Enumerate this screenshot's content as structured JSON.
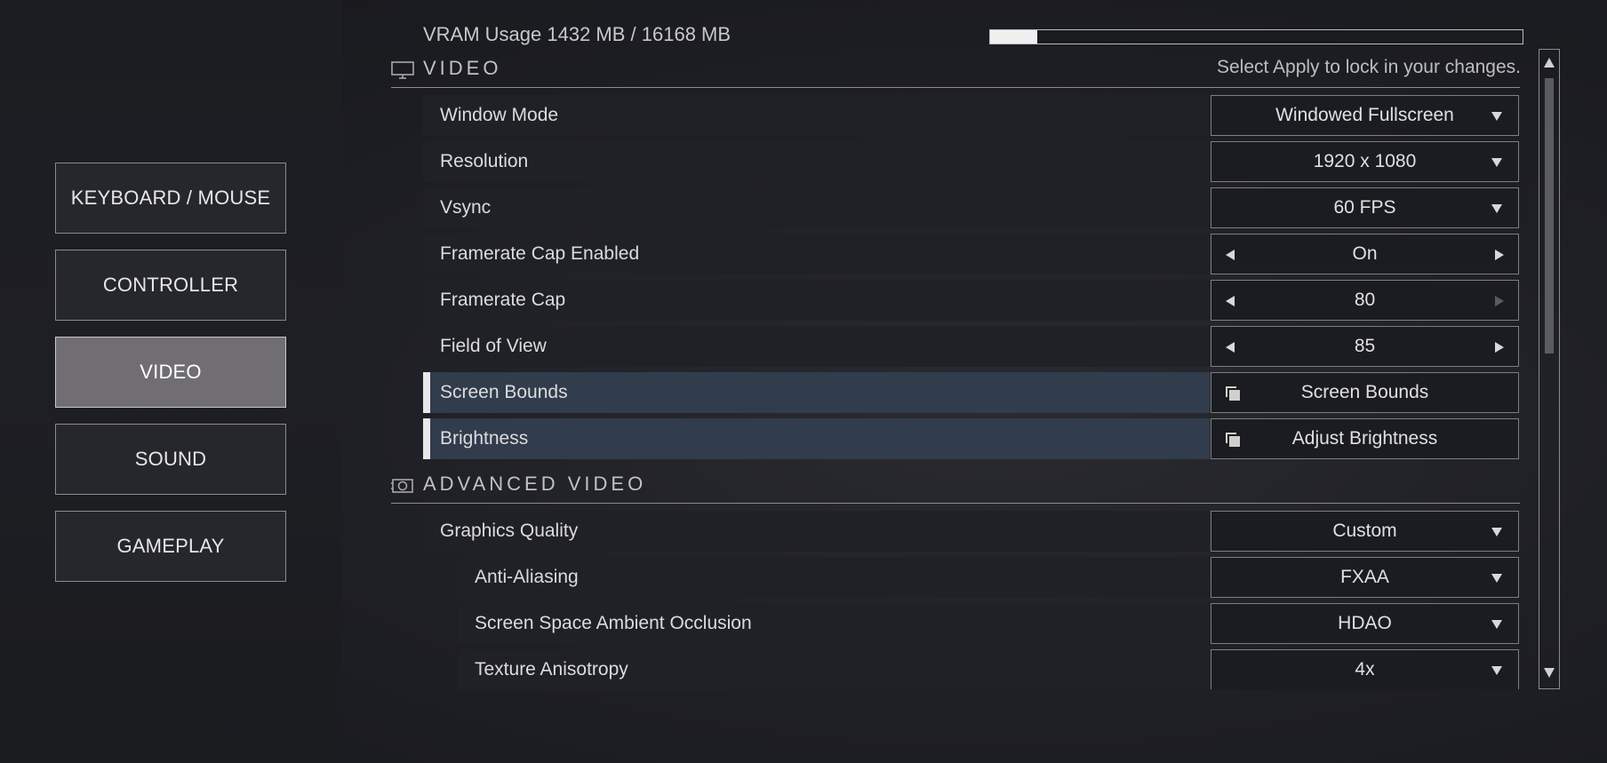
{
  "nav": {
    "items": [
      {
        "label": "KEYBOARD / MOUSE",
        "active": false
      },
      {
        "label": "CONTROLLER",
        "active": false
      },
      {
        "label": "VIDEO",
        "active": true
      },
      {
        "label": "SOUND",
        "active": false
      },
      {
        "label": "GAMEPLAY",
        "active": false
      }
    ]
  },
  "vram": {
    "label": "VRAM Usage 1432 MB / 16168 MB",
    "used_mb": 1432,
    "total_mb": 16168
  },
  "video_section": {
    "title": "VIDEO",
    "hint": "Select Apply to lock in your changes.",
    "icon": "monitor-icon",
    "settings": [
      {
        "label": "Window Mode",
        "value": "Windowed Fullscreen",
        "control": "dropdown"
      },
      {
        "label": "Resolution",
        "value": "1920 x 1080",
        "control": "dropdown"
      },
      {
        "label": "Vsync",
        "value": "60 FPS",
        "control": "dropdown"
      },
      {
        "label": "Framerate Cap Enabled",
        "value": "On",
        "control": "stepper"
      },
      {
        "label": "Framerate Cap",
        "value": "80",
        "control": "stepper"
      },
      {
        "label": "Field of View",
        "value": "85",
        "control": "stepper"
      },
      {
        "label": "Screen Bounds",
        "value": "Screen Bounds",
        "control": "button"
      },
      {
        "label": "Brightness",
        "value": "Adjust Brightness",
        "control": "button"
      }
    ]
  },
  "advanced_section": {
    "title": "ADVANCED VIDEO",
    "icon": "graphics-card-icon",
    "settings": [
      {
        "label": "Graphics Quality",
        "value": "Custom",
        "control": "dropdown"
      },
      {
        "label": "Anti-Aliasing",
        "value": "FXAA",
        "control": "dropdown"
      },
      {
        "label": "Screen Space Ambient Occlusion",
        "value": "HDAO",
        "control": "dropdown"
      },
      {
        "label": "Texture Anisotropy",
        "value": "4x",
        "control": "dropdown"
      }
    ]
  },
  "colors": {
    "accent_highlight": "#313c4c",
    "active_nav": "#706e73"
  }
}
